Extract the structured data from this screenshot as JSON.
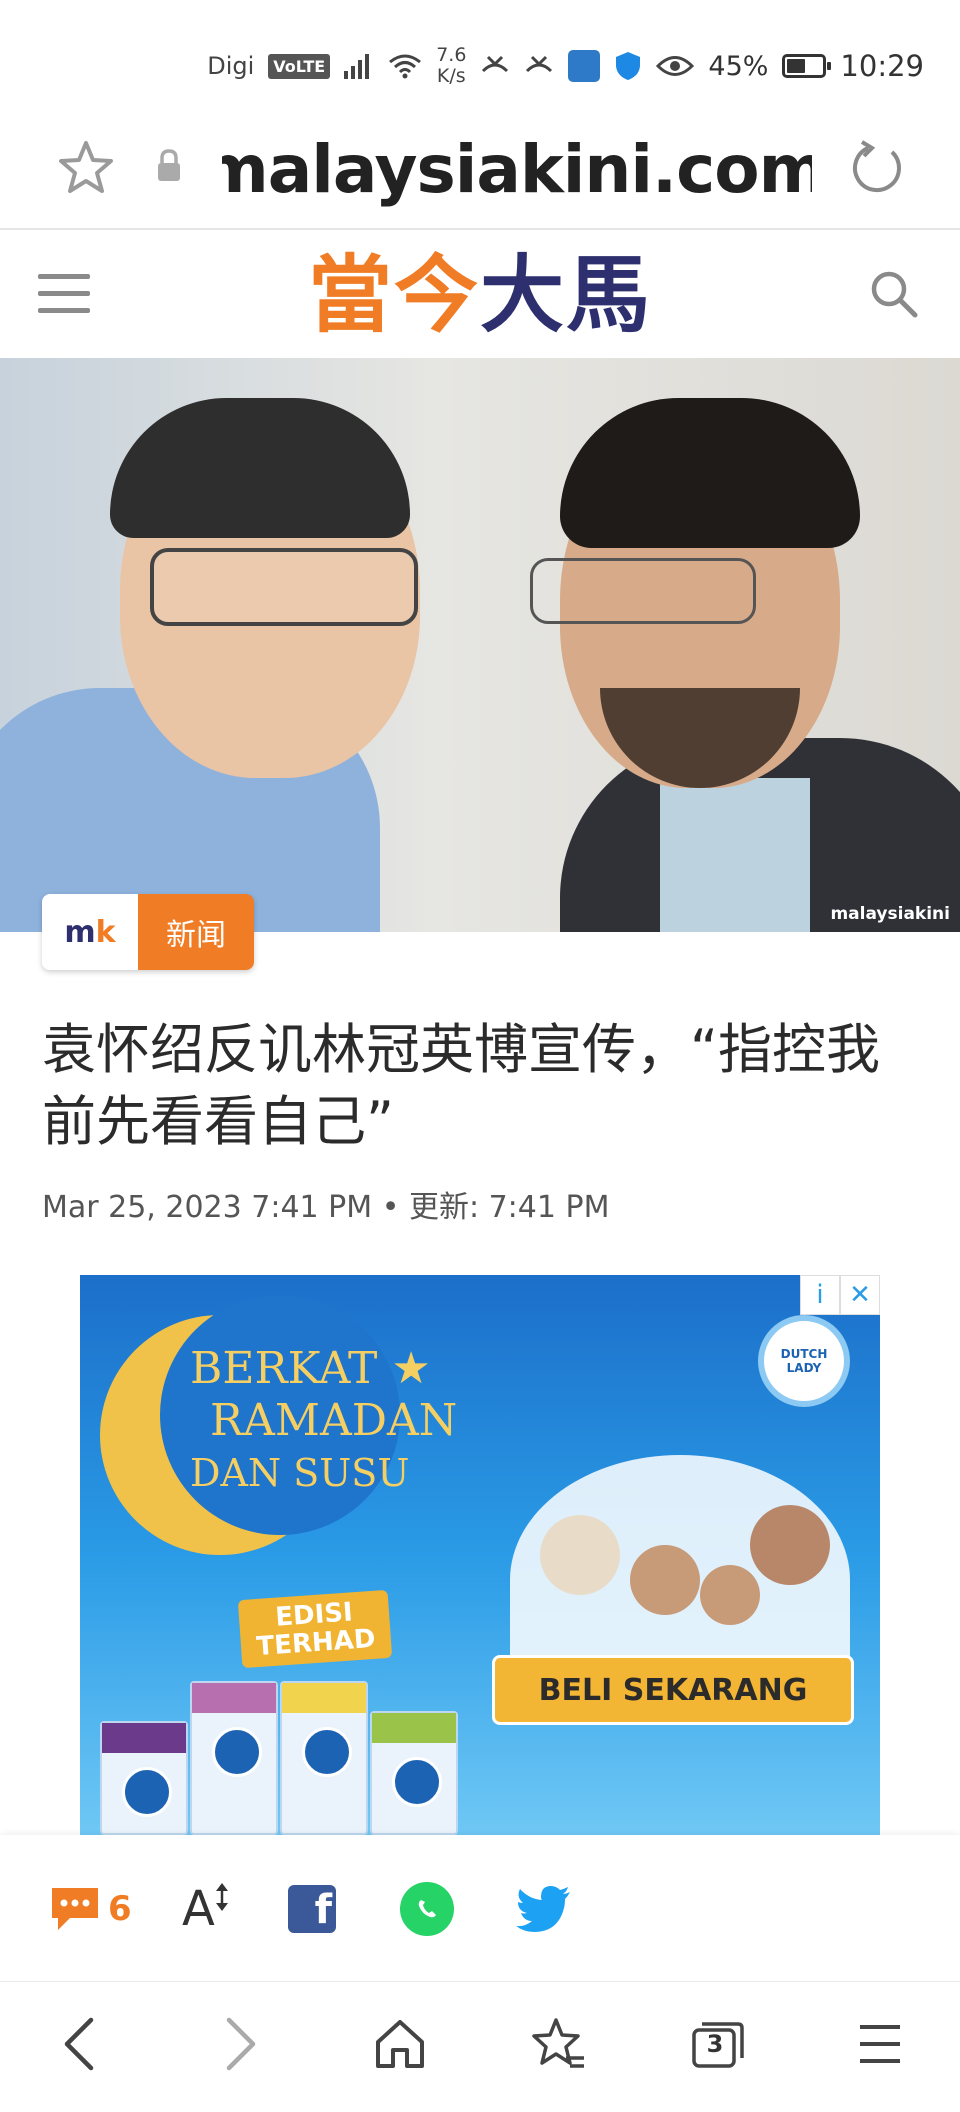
{
  "status_bar": {
    "carrier": "Digi",
    "volte": "VoLTE",
    "net_speed_value": "7.6",
    "net_speed_unit": "K/s",
    "battery_percent": "45%",
    "battery_level": 0.45,
    "time": "10:29"
  },
  "browser": {
    "url": "malaysiakini.com",
    "tab_count": "3"
  },
  "site": {
    "logo_part1": "當今",
    "logo_part2": "大馬"
  },
  "hero": {
    "watermark": "malaysiakini",
    "badge_logo_m": "m",
    "badge_logo_k": "k",
    "category": "新闻"
  },
  "article": {
    "headline": "袁怀绍反讥林冠英博宣传，“指控我前先看看自己”",
    "date": "Mar 25, 2023 7:41 PM",
    "separator": "•",
    "updated": "更新: 7:41 PM"
  },
  "ad": {
    "info": "i",
    "close": "✕",
    "line1": "BERKAT ★",
    "line2": "RAMADAN",
    "line3": "DAN SUSU",
    "edition": "EDISI TERHAD",
    "brand": "DUTCH LADY",
    "cta": "BELI SEKARANG"
  },
  "actions": {
    "comment_count": "6",
    "font_size_label": "A",
    "facebook_letter": "f"
  },
  "colors": {
    "brand_orange": "#f07d26",
    "brand_navy": "#2d2f6e",
    "facebook": "#3b5998",
    "whatsapp": "#25d366",
    "twitter": "#1da1f2"
  }
}
